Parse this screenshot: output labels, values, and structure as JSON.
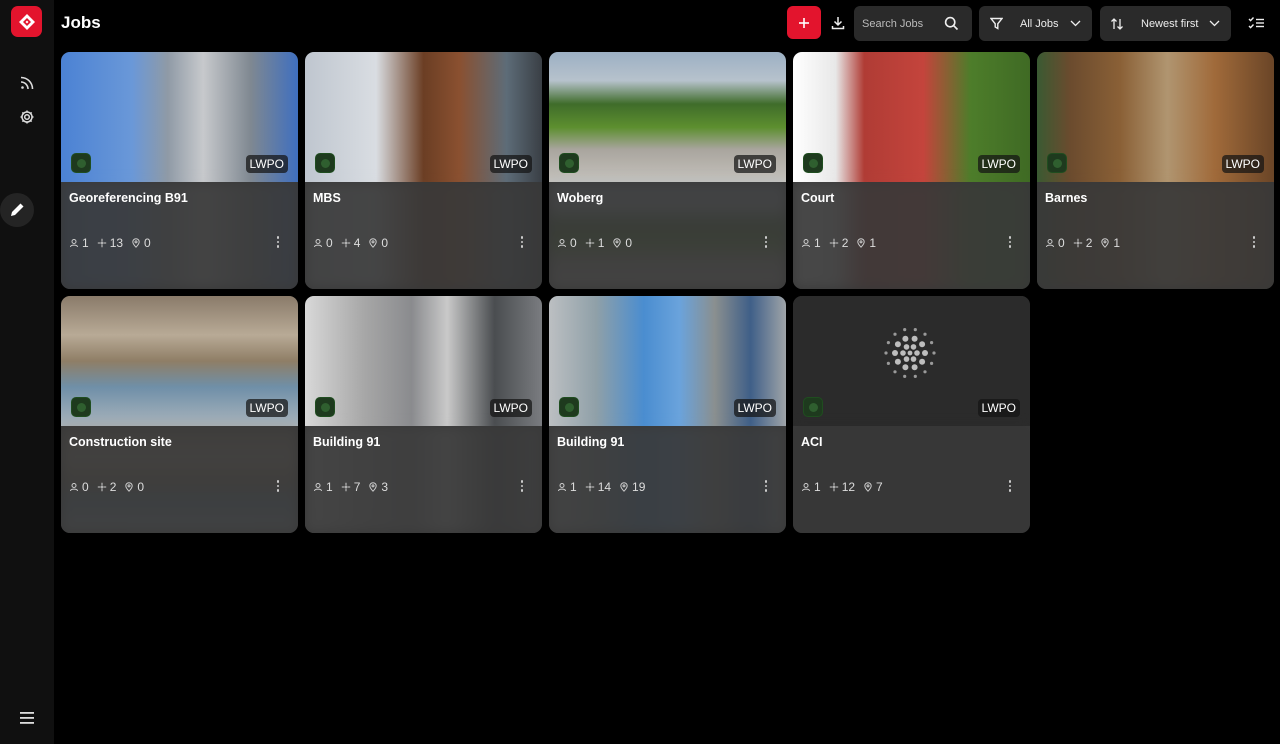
{
  "header": {
    "title": "Jobs",
    "search_placeholder": "Search Jobs",
    "filter_label": "All Jobs",
    "sort_label": "Newest first"
  },
  "colors": {
    "brand": "#e3142d",
    "card": "#333333",
    "status_ok": "#1e3a1e"
  },
  "jobs": [
    {
      "title": "Georeferencing B91",
      "badge": "LWPO",
      "stat1": "1",
      "stat2": "13",
      "stat3": "0",
      "thumb": "building-scaffold"
    },
    {
      "title": "MBS",
      "badge": "LWPO",
      "stat1": "0",
      "stat2": "4",
      "stat3": "0",
      "thumb": "street-building"
    },
    {
      "title": "Woberg",
      "badge": "LWPO",
      "stat1": "0",
      "stat2": "1",
      "stat3": "0",
      "thumb": "garden-terrace"
    },
    {
      "title": "Court",
      "badge": "LWPO",
      "stat1": "1",
      "stat2": "2",
      "stat3": "1",
      "thumb": "red-court"
    },
    {
      "title": "Barnes",
      "badge": "LWPO",
      "stat1": "0",
      "stat2": "2",
      "stat3": "1",
      "thumb": "wooden-barn"
    },
    {
      "title": "Construction site",
      "badge": "LWPO",
      "stat1": "0",
      "stat2": "2",
      "stat3": "0",
      "thumb": "construction-interior"
    },
    {
      "title": "Building 91",
      "badge": "LWPO",
      "stat1": "1",
      "stat2": "7",
      "stat3": "3",
      "thumb": "garage-scanner"
    },
    {
      "title": "Building 91",
      "badge": "LWPO",
      "stat1": "1",
      "stat2": "14",
      "stat3": "19",
      "thumb": "scaffold-facade"
    },
    {
      "title": "ACI",
      "badge": "LWPO",
      "stat1": "1",
      "stat2": "12",
      "stat3": "7",
      "thumb": "processing-spinner"
    }
  ]
}
